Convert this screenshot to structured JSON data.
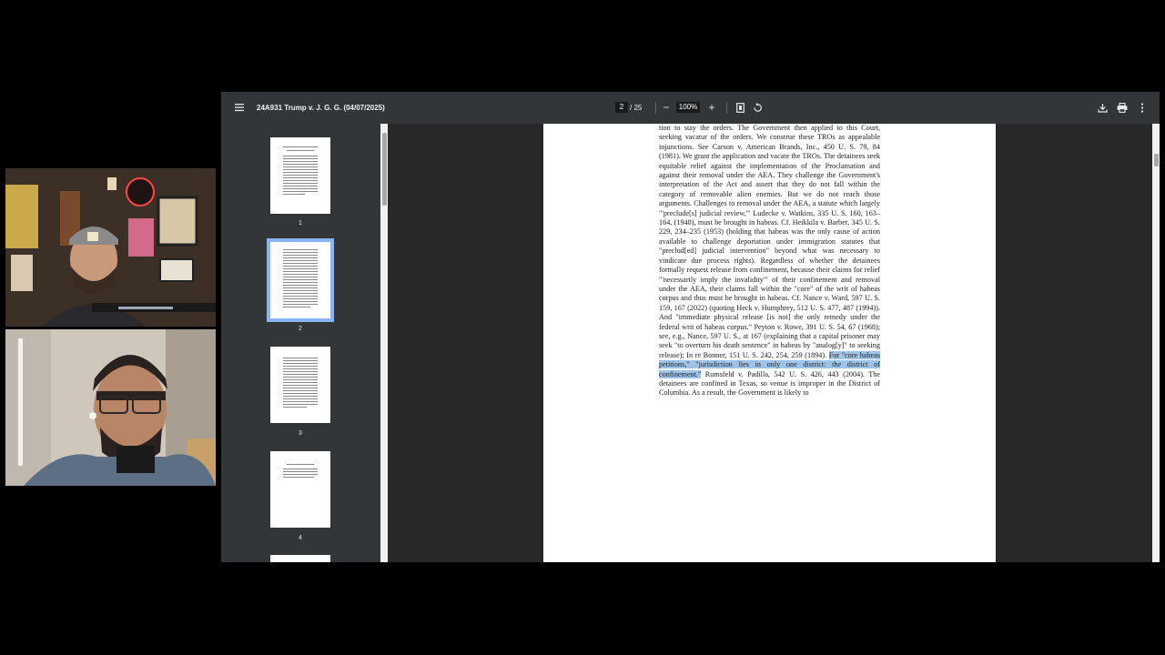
{
  "toolbar": {
    "menu_icon": "menu-icon",
    "title": "24A931 Trump v. J. G. G. (04/07/2025)",
    "page_current": "2",
    "page_total": "/ 25",
    "zoom": "100%",
    "zoom_out_label": "−",
    "zoom_in_label": "+",
    "fit_icon": "fit-page-icon",
    "rotate_icon": "rotate-icon",
    "download_icon": "download-icon",
    "print_icon": "print-icon",
    "more_icon": "more-vert-icon"
  },
  "sidebar": {
    "thumbnails": [
      {
        "number": "1",
        "selected": false
      },
      {
        "number": "2",
        "selected": true
      },
      {
        "number": "3",
        "selected": false
      },
      {
        "number": "4",
        "selected": false
      }
    ]
  },
  "page": {
    "text_before_highlight": "tion to stay the orders. The Government then applied to this Court, seeking vacatur of the orders. We construe these TROs as appealable injunctions. See Carson v. American Brands, Inc., 450 U. S. 79, 84 (1981). We grant the application and vacate the TROs. The detainees seek equitable relief against the implementation of the Proclamation and against their removal under the AEA. They challenge the Government's interpretation of the Act and assert that they do not fall within the category of removable alien enemies. But we do not reach those arguments. Challenges to removal under the AEA, a statute which largely \"'preclude[s] judicial review,'\" Ludecke v. Watkins, 335 U. S. 160, 163–164, (1948), must be brought in habeas. Cf. Heikkila v. Barber, 345 U. S. 229, 234–235 (1953) (holding that habeas was the only cause of action available to challenge deportation under immigration statutes that \"preclud[ed] judicial intervention\" beyond what was necessary to vindicate due process rights). Regardless of whether the detainees formally request release from confinement, because their claims for relief \"'necessarily imply the invalidity'\" of their confinement and removal under the AEA, their claims fall within the \"core\" of the writ of habeas corpus and thus must be brought in habeas. Cf. Nance v. Ward, 597 U. S. 159, 167 (2022) (quoting Heck v. Humphrey, 512 U. S. 477, 487 (1994)). And \"immediate physical release [is not] the only remedy under the federal writ of habeas corpus.\" Peyton v. Rowe, 391 U. S. 54, 67 (1968); see, e.g., Nance, 597 U. S., at 167 (explaining that a capital prisoner may seek \"to overturn his death sentence\" in habeas by \"analog[y]\" to seeking release); In re Bonner, 151 U. S. 242, 254, 259 (1894). ",
    "text_highlight": "For \"core habeas petitions,\" \"jurisdiction lies in only one district: the district of confinement.\"",
    "text_after_highlight": " Rumsfeld v. Padilla, 542 U. S. 426, 443 (2004). The detainees are confined in Texas, so venue is improper in the District of Columbia. As a result, the Government is likely to"
  },
  "colors": {
    "toolbar_bg": "#323639",
    "viewer_bg": "#282828",
    "selection_outline": "#8ab4f8",
    "highlight": "#9fc3e6"
  }
}
